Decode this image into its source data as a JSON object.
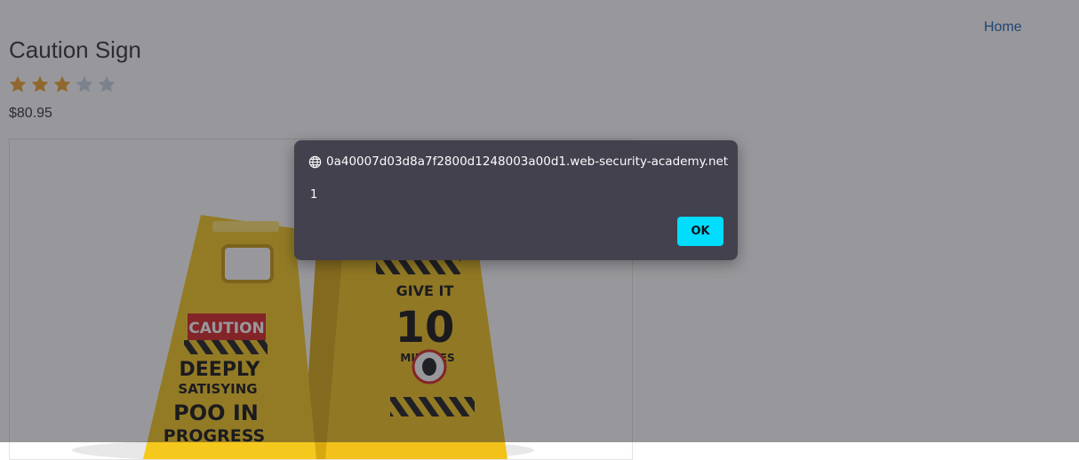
{
  "nav": {
    "home_label": "Home"
  },
  "product": {
    "title": "Caution Sign",
    "rating": {
      "value": 3,
      "max": 5
    },
    "price": "$80.95",
    "image": {
      "sign_left": {
        "header": "CAUTION",
        "lines": [
          "DEEPLY",
          "SATISYING",
          "POO IN",
          "PROGRESS"
        ]
      },
      "sign_right": {
        "lines": [
          "GIVE IT",
          "10",
          "MINUTES"
        ]
      }
    }
  },
  "dialog": {
    "origin": "0a40007d03d8a7f2800d1248003a00d1.web-security-academy.net",
    "message": "1",
    "ok_label": "OK"
  },
  "colors": {
    "link": "#1a5eae",
    "star_filled": "#f0a42e",
    "star_empty": "#c9d3e0",
    "dialog_bg": "#42414d",
    "ok_button": "#00ddff",
    "sign_yellow": "#f5c81e"
  },
  "icons": {
    "dialog_origin": "globe-icon",
    "rating": "star-icon"
  }
}
